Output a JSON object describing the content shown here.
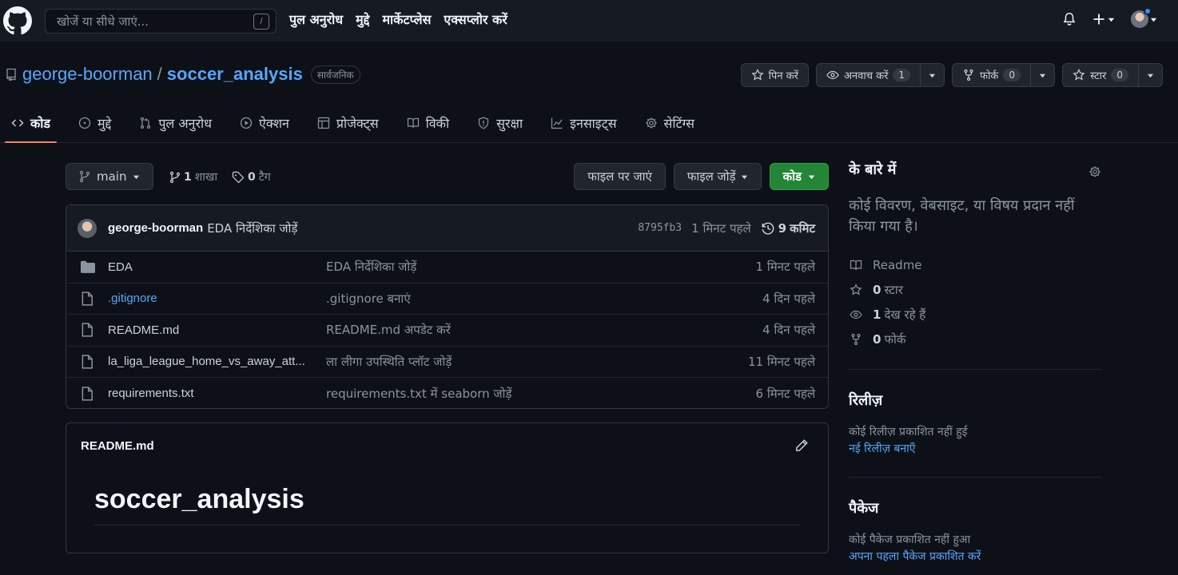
{
  "nav": {
    "search_placeholder": "खोजें या सीधे जाएं...",
    "slash_key": "/",
    "links": [
      "पुल अनुरोध",
      "मुद्दे",
      "मार्केटप्लेस",
      "एक्सप्लोर करें"
    ]
  },
  "repo": {
    "owner": "george-boorman",
    "separator": "/",
    "name": "soccer_analysis",
    "visibility": "सार्वजनिक",
    "pin_label": "पिन करें",
    "watch_label": "अनवाच करें",
    "watch_count": "1",
    "fork_label": "फोर्क",
    "fork_count": "0",
    "star_label": "स्टार",
    "star_count": "0"
  },
  "tabs": [
    "कोड",
    "मुद्दे",
    "पुल अनुरोध",
    "ऐक्शन",
    "प्रोजेक्ट्स",
    "विकी",
    "सुरक्षा",
    "इनसाइट्स",
    "सेटिंग्स"
  ],
  "branch": {
    "name": "main",
    "branch_count": "1",
    "branch_label": "शाखा",
    "tag_count": "0",
    "tag_label": "टैग",
    "goto_file": "फाइल पर जाएं",
    "add_file": "फाइल जोड़ें",
    "code_button": "कोड"
  },
  "latest_commit": {
    "author": "george-boorman",
    "message": "EDA निर्देशिका जोड़ें",
    "sha": "8795fb3",
    "time": "1 मिनट पहले",
    "commit_count": "9",
    "commit_label": "कमिट"
  },
  "files": [
    {
      "name": "EDA",
      "type": "folder",
      "message": "EDA निर्देशिका जोड़ें",
      "time": "1 मिनट पहले"
    },
    {
      "name": ".gitignore",
      "type": "file",
      "message": ".gitignore बनाएं",
      "time": "4 दिन पहले"
    },
    {
      "name": "README.md",
      "type": "file",
      "message": "README.md अपडेट करें",
      "time": "4 दिन पहले"
    },
    {
      "name": "la_liga_league_home_vs_away_att...",
      "type": "file",
      "message": "ला लीगा उपस्थिति प्लॉट जोड़ें",
      "time": "11 मिनट पहले"
    },
    {
      "name": "requirements.txt",
      "type": "file",
      "message": "requirements.txt में seaborn जोड़ें",
      "time": "6 मिनट पहले"
    }
  ],
  "readme": {
    "filename": "README.md",
    "heading": "soccer_analysis"
  },
  "sidebar": {
    "about_title": "के बारे में",
    "about_desc": "कोई विवरण, वेबसाइट, या विषय प्रदान नहीं किया गया है।",
    "readme_label": "Readme",
    "stars_count": "0",
    "stars_label": "स्टार",
    "watching_count": "1",
    "watching_label": "देख रहे हैं",
    "forks_count": "0",
    "forks_label": "फोर्क",
    "releases_title": "रिलीज़",
    "releases_empty": "कोई रिलीज़ प्रकाशित नहीं हुई",
    "releases_link": "नई रिलीज़ बनाएँ",
    "packages_title": "पैकेज",
    "packages_empty": "कोई पैकेज प्रकाशित नहीं हुआ",
    "packages_link": "अपना पहला पैकेज प्रकाशित करें"
  },
  "colors": {
    "accent_link": "#58a6ff",
    "tab_underline": "#f78166",
    "primary_button": "#238636"
  }
}
